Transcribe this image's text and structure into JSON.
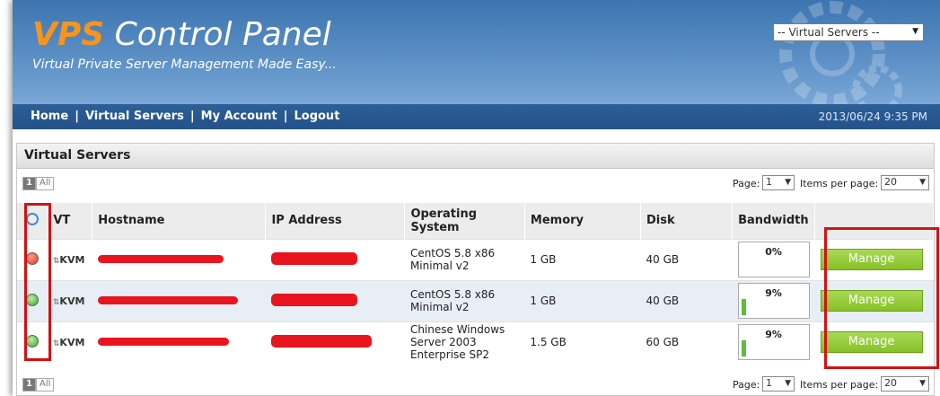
{
  "header": {
    "brand_prefix": "VPS",
    "brand_suffix": "Control Panel",
    "tagline": "Virtual Private Server Management Made Easy...",
    "server_select": "-- Virtual Servers --"
  },
  "nav": {
    "links": [
      "Home",
      "Virtual Servers",
      "My Account",
      "Logout"
    ],
    "separator": "|",
    "datetime": "2013/06/24 9:35 PM"
  },
  "panel": {
    "title": "Virtual Servers",
    "pager": {
      "page_button": "1",
      "all_button": "All",
      "page_label": "Page:",
      "page_value": "1",
      "per_page_label": "Items per page:",
      "per_page_value": "20"
    },
    "columns": [
      "VT",
      "Hostname",
      "IP Address",
      "Operating System",
      "Memory",
      "Disk",
      "Bandwidth"
    ],
    "rows": [
      {
        "status": "stopped",
        "vt": "KVM",
        "os": "CentOS 5.8 x86 Minimal v2",
        "memory": "1 GB",
        "disk": "40 GB",
        "bandwidth": "0%",
        "bandwidth_fraction": 0.0,
        "action": "Manage"
      },
      {
        "status": "running",
        "vt": "KVM",
        "os": "CentOS 5.8 x86 Minimal v2",
        "memory": "1 GB",
        "disk": "40 GB",
        "bandwidth": "9%",
        "bandwidth_fraction": 0.09,
        "action": "Manage"
      },
      {
        "status": "running",
        "vt": "KVM",
        "os": "Chinese Windows Server 2003 Enterprise SP2",
        "memory": "1.5 GB",
        "disk": "60 GB",
        "bandwidth": "9%",
        "bandwidth_fraction": 0.09,
        "action": "Manage"
      }
    ]
  },
  "colors": {
    "header_blue": "#4a82bd",
    "nav_blue": "#2d5f97",
    "brand_orange": "#f7941d",
    "manage_green": "#8ec63f",
    "highlight_red": "#d21111"
  }
}
